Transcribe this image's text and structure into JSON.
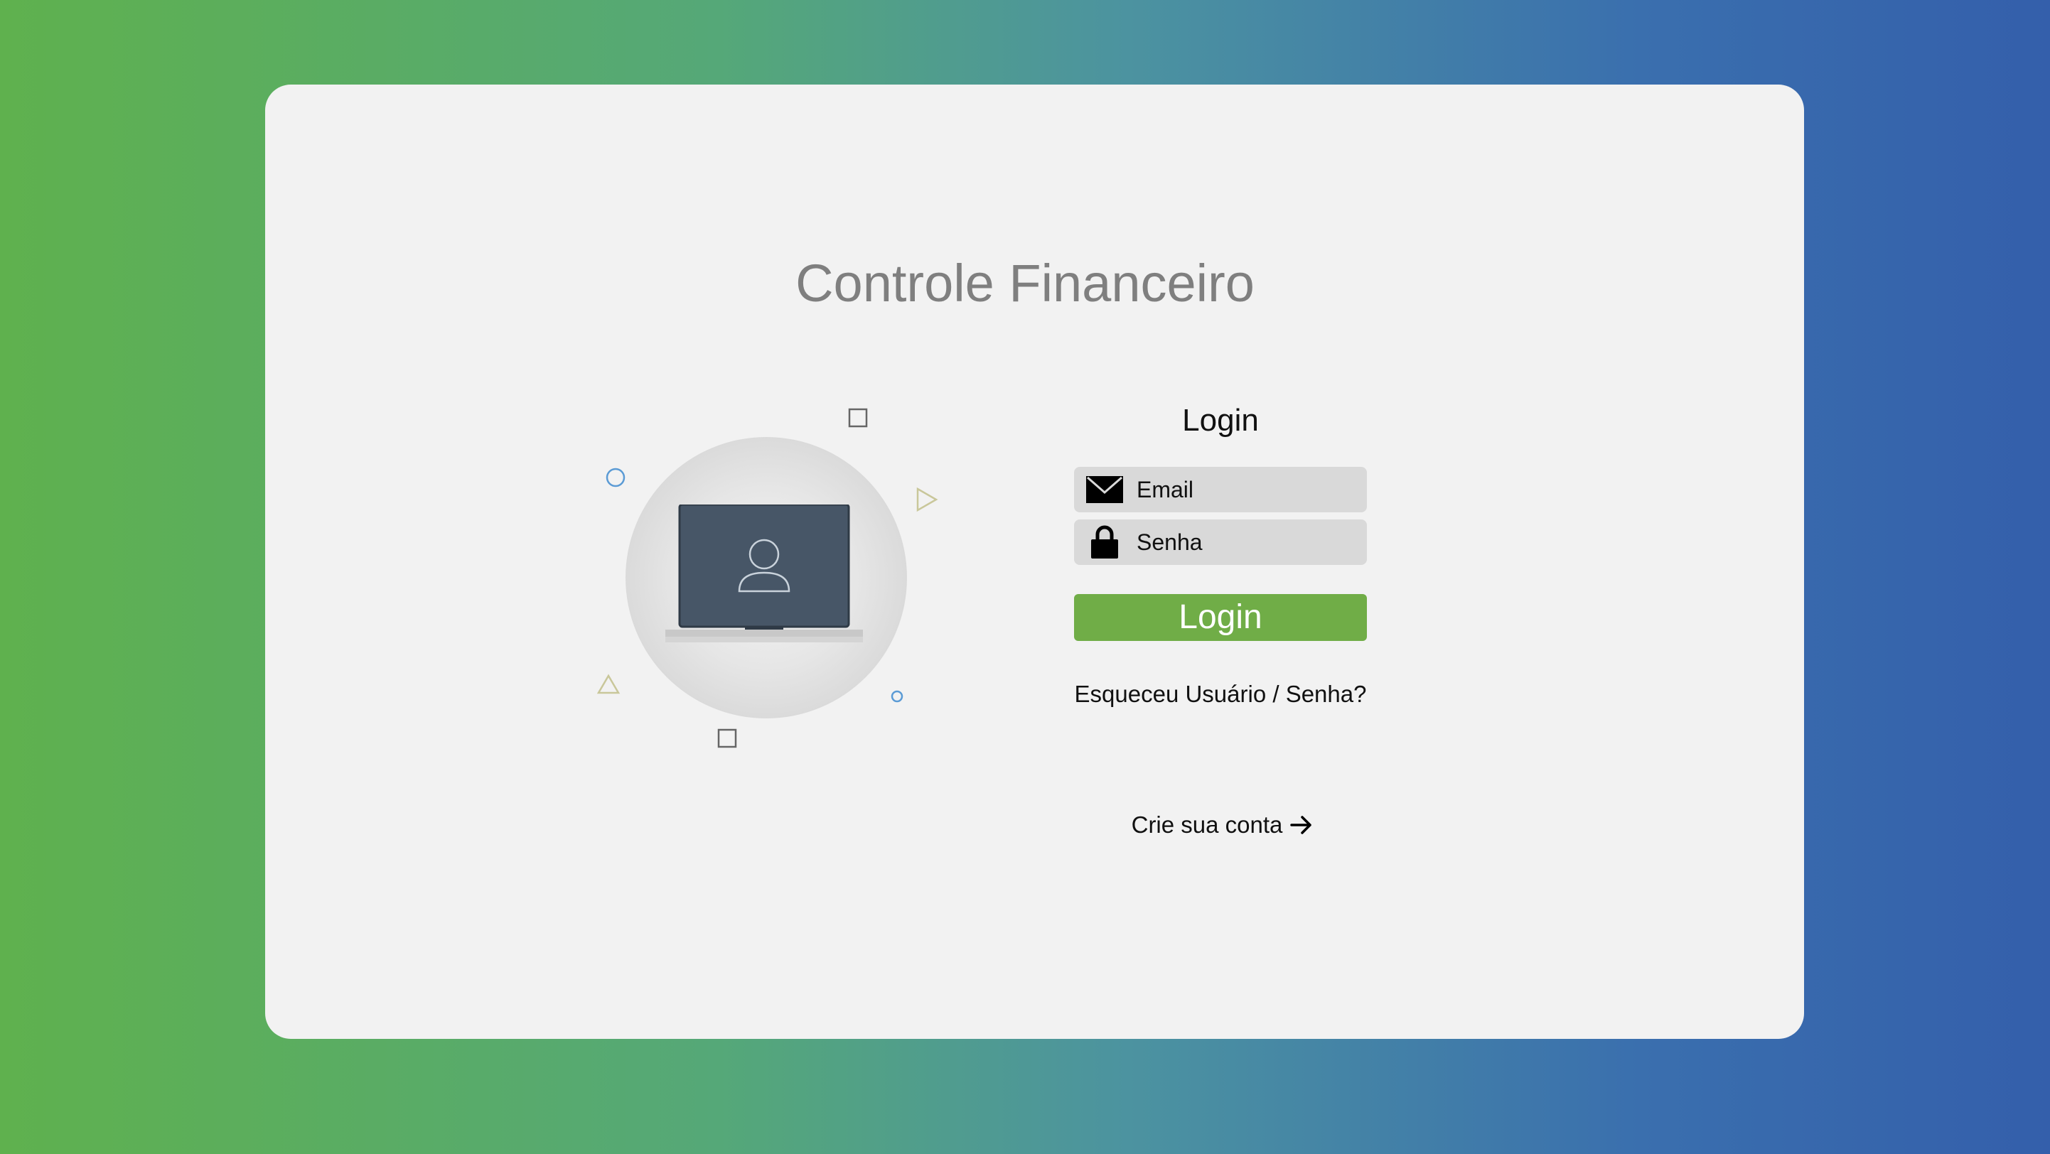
{
  "app": {
    "title": "Controle Financeiro"
  },
  "login": {
    "heading": "Login",
    "email": {
      "placeholder": "Email",
      "icon": "envelope-icon"
    },
    "password": {
      "placeholder": "Senha",
      "icon": "lock-icon"
    },
    "button_label": "Login",
    "forgot_link": "Esqueceu Usuário / Senha?",
    "signup_link": "Crie sua conta",
    "signup_icon": "arrow-right-icon"
  },
  "illustration": {
    "icon": "laptop-user-icon"
  },
  "colors": {
    "gradient_start": "#5fb14e",
    "gradient_end": "#345fab",
    "card": "#f2f2f2",
    "button": "#70ad47",
    "field": "#d9d9d9",
    "title": "#7f7f7f"
  }
}
